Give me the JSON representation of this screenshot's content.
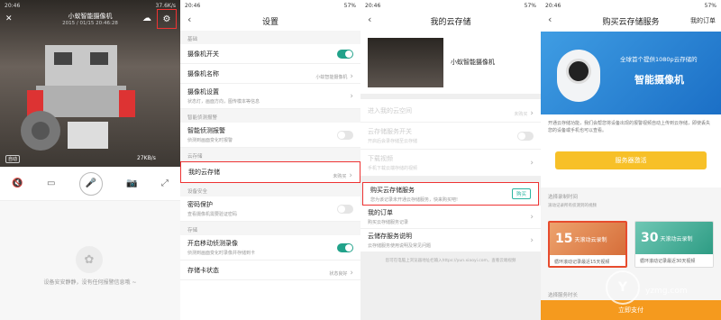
{
  "panel1": {
    "status": {
      "time": "20:46",
      "speed": "37.6K/s",
      "net": "4G",
      "battery": "57%"
    },
    "video_title": "小蚁智能摄像机",
    "video_sub": "2015 / 01/15 20:46:28",
    "auto_label": "自动",
    "speed_label": "27KB/s",
    "empty_text": "设备安安静静，没有任何报警信息哦 ~"
  },
  "panel2": {
    "status": {
      "time": "20:46",
      "speed": "0.08K/s",
      "net": "4G",
      "battery": "57%"
    },
    "title": "设置",
    "sections": {
      "basic": "基础",
      "smart": "智能侦测报警",
      "storage": "云存储",
      "security": "设备安全",
      "disk": "存储"
    },
    "rows": {
      "camera_switch": "摄像机开关",
      "camera_name": "摄像机名称",
      "camera_name_val": "小蚁智能摄像机",
      "camera_settings": "摄像机设置",
      "camera_settings_desc": "状态灯，画面方向，图传模本等信息",
      "smart_alarm": "智能侦测报警",
      "smart_alarm_desc": "侦测到画面变化时报警",
      "my_storage": "我的云存储",
      "my_storage_val": "未购买",
      "password": "密码保护",
      "password_desc": "查看摄像机需要验证密码",
      "motion_record": "开启移动侦测录像",
      "motion_record_desc": "侦测到画面变化时录像并存储到卡",
      "sd_status": "存储卡状态",
      "sd_status_val": "状态良好"
    }
  },
  "panel3": {
    "status": {
      "time": "20:46",
      "speed": "0.17K/s",
      "net": "4G",
      "battery": "57%"
    },
    "title": "我的云存储",
    "cam_name": "小蚁智能摄像机",
    "rows": {
      "enter": "进入我的云空间",
      "enter_val": "未购买",
      "switch": "云存储服务开关",
      "switch_desc": "开启后会录存储至云存储",
      "download": "下载视频",
      "download_desc": "手机下载云端存储的视频",
      "buy": "购买云存储服务",
      "buy_desc": "您为该记录未开通云存储服务，快来购买吧!",
      "buy_btn": "购买",
      "orders": "我的订单",
      "orders_desc": "购买云存储服务记录",
      "help": "云储存服务说明",
      "help_desc": "云存储服务使用说明及常见问题"
    },
    "footer": "您可在电脑上浏览器地址栏输入https://yun.xiaoyi.com，查看云端视频"
  },
  "panel4": {
    "status": {
      "time": "20:46",
      "speed": "0.69K/s",
      "net": "4G",
      "battery": "57%"
    },
    "title": "购买云存储服务",
    "orders_link": "我的订单",
    "banner_line1": "全球首个提供1080p云存储的",
    "banner_line2": "智能摄像机",
    "desc": "开通云存储功能，我们会帮您将设备出现的报警视频自动上传到云存储，即使丢失您的设备或手机也可以查看。",
    "activate": "服务器激活",
    "select_time": "选择录制时间",
    "select_sub": "滚动记录所有侦测到的视频",
    "plan1_big": "15",
    "plan1_small": "天滚动云录制",
    "plan1_foot": "循环滚动记录最近15天视频",
    "plan2_big": "30",
    "plan2_small": "天滚动云录制",
    "plan2_foot": "循环滚动记录最近30天视频",
    "select_period": "选择服务时长",
    "pay": "立即支付",
    "watermark_logo": "Y",
    "watermark": "yzmg.com"
  },
  "colors": {
    "accent_green": "#21a28a",
    "highlight_red": "#e33333",
    "orange": "#f59a1e",
    "yellow": "#f7c028"
  }
}
